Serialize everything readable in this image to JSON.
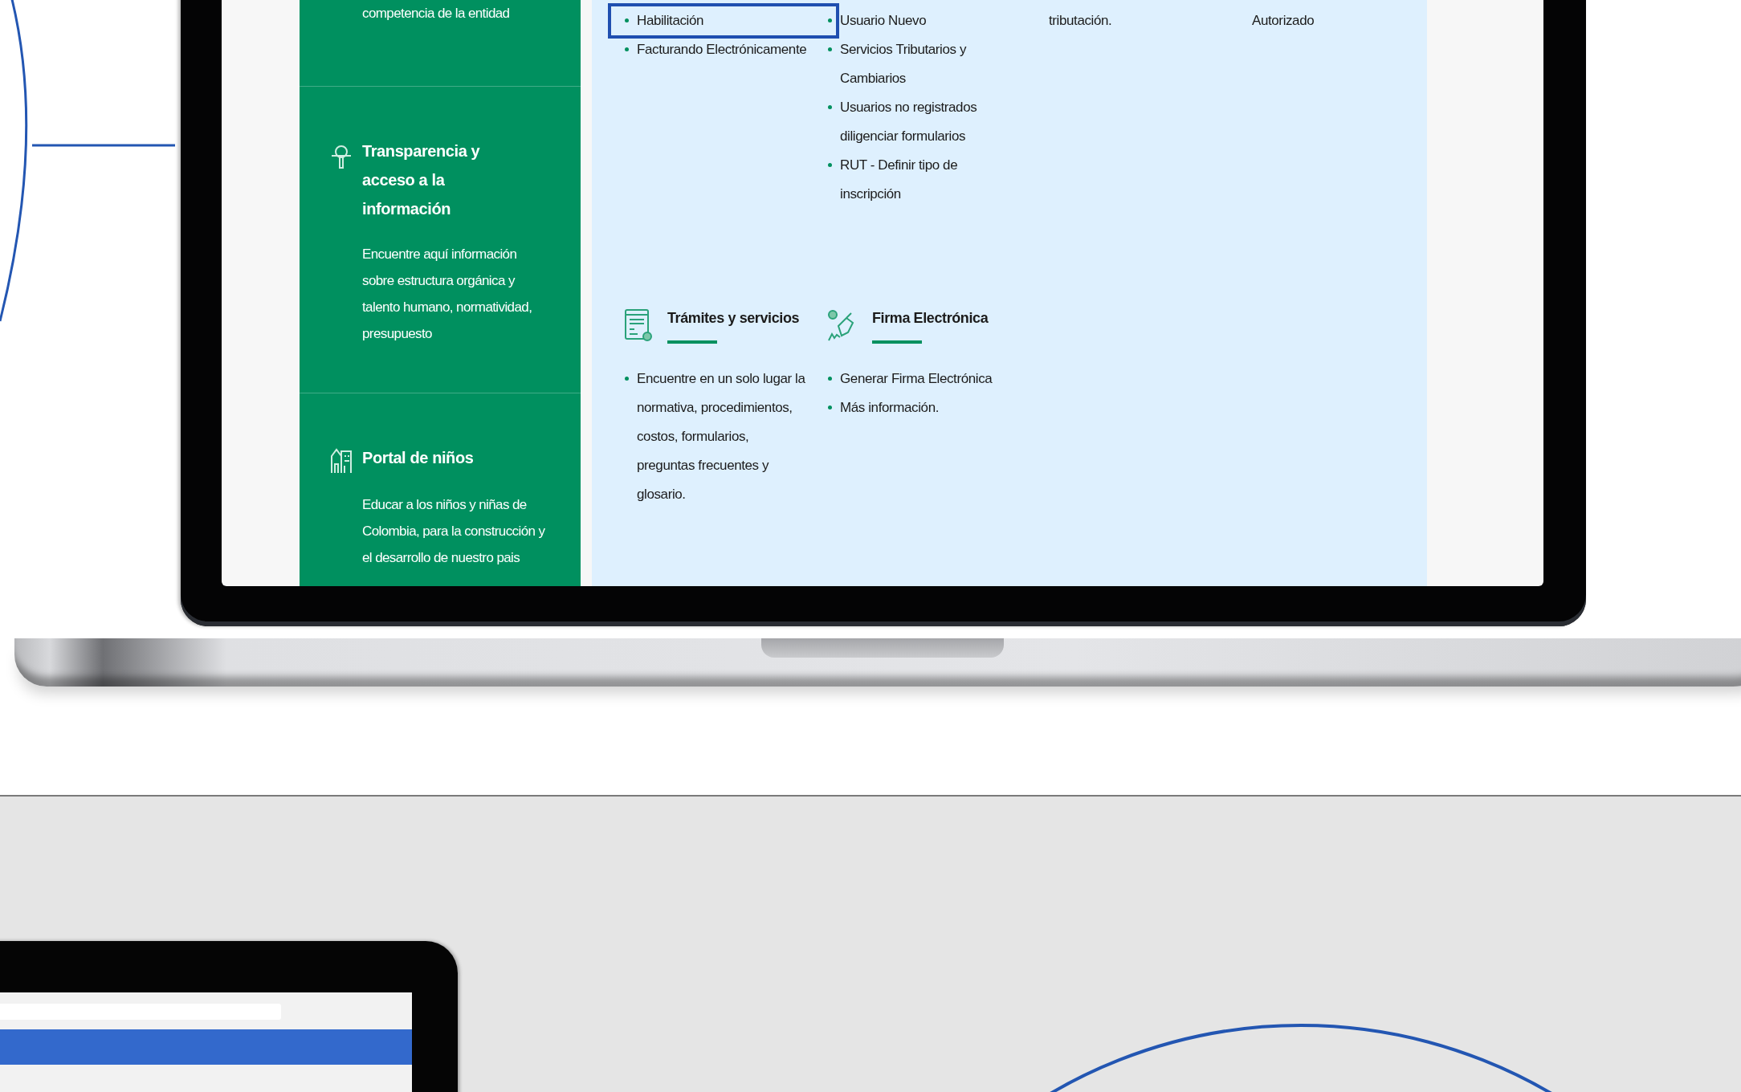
{
  "sidebar": {
    "sections": [
      {
        "kind": "fragment",
        "description": "competencia de la entidad"
      },
      {
        "kind": "transparency",
        "title": "Transparencia y acceso a la información",
        "description": "Encuentre aquí información sobre estructura orgánica y talento humano, normatividad, presupuesto"
      },
      {
        "kind": "kids",
        "title": "Portal de niños",
        "description": "Educar a los niños y niñas de Colombia, para la construcción y el desarrollo de nuestro pais"
      }
    ]
  },
  "upper_lists": [
    {
      "items": [
        {
          "text": "Habilitación",
          "selected": true
        },
        {
          "text": "Facturando Electrónicamente",
          "selected": false
        }
      ]
    },
    {
      "items": [
        {
          "text": "Usuario Nuevo",
          "selected": false
        },
        {
          "text": "Servicios Tributarios y Cambiarios",
          "selected": false
        },
        {
          "text": "Usuarios no registrados diligenciar formularios",
          "selected": false
        },
        {
          "text": "RUT - Definir tipo de inscripción",
          "selected": false
        }
      ]
    }
  ],
  "trailing_texts": [
    "tributación.",
    "Autorizado"
  ],
  "services": [
    {
      "kind": "procedures",
      "title": "Trámites y servicios",
      "items": [
        "Encuentre en un solo lugar la normativa, procedimientos, costos, formularios, preguntas frecuentes y glosario."
      ]
    },
    {
      "kind": "signature",
      "title": "Firma Electrónica",
      "items": [
        "Generar Firma Electrónica",
        "Más información."
      ]
    }
  ]
}
